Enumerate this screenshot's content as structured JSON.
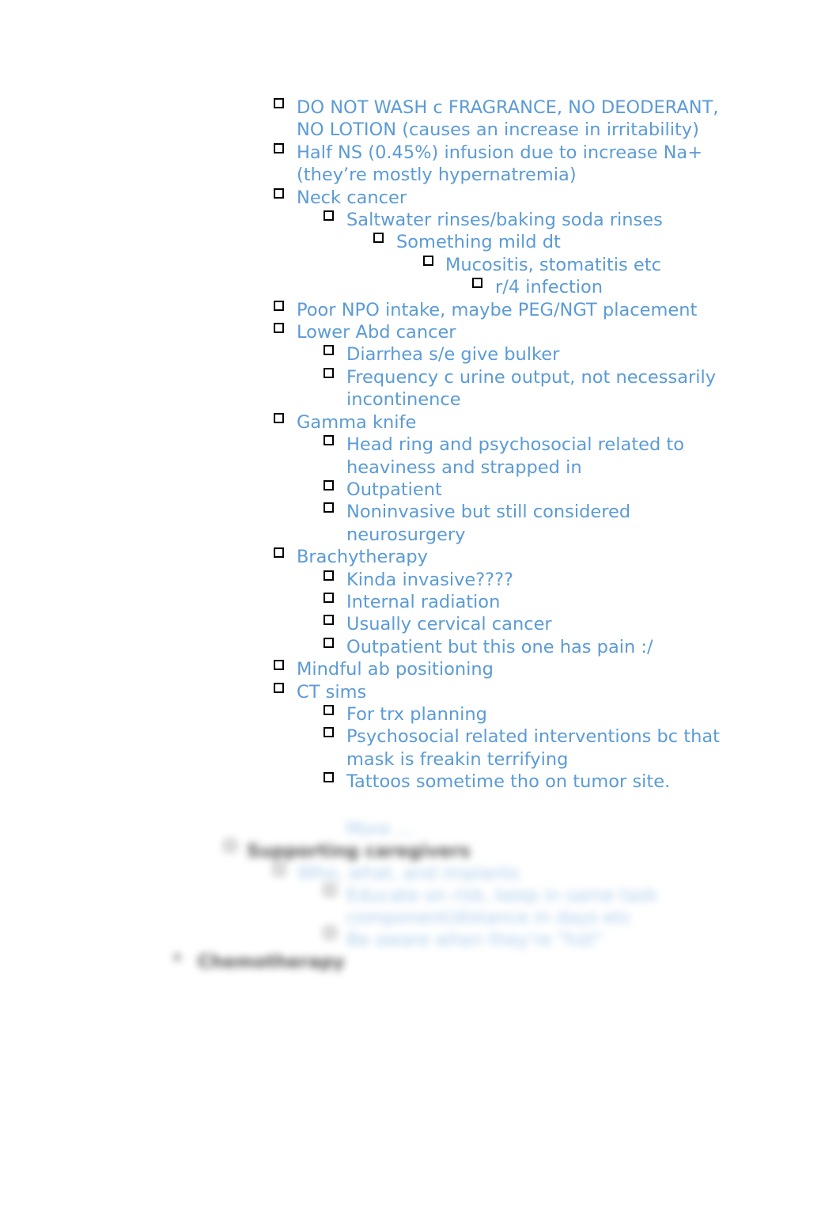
{
  "document": {
    "text_color": "#5b9bd5",
    "items": [
      {
        "level": 0,
        "text": "DO NOT WASH c FRAGRANCE, NO DEODERANT, NO LOTION (causes an increase in irritability)"
      },
      {
        "level": 0,
        "text": "Half NS (0.45%) infusion due to increase Na+ (they’re mostly hypernatremia)"
      },
      {
        "level": 0,
        "text": "Neck cancer"
      },
      {
        "level": 1,
        "text": "Saltwater rinses/baking soda rinses"
      },
      {
        "level": 2,
        "text": "Something mild dt"
      },
      {
        "level": 3,
        "text": "Mucositis, stomatitis etc"
      },
      {
        "level": 4,
        "text": "r/4 infection"
      },
      {
        "level": 0,
        "text": "Poor NPO intake, maybe PEG/NGT placement"
      },
      {
        "level": 0,
        "text": "Lower Abd cancer"
      },
      {
        "level": 1,
        "text": "Diarrhea s/e give bulker"
      },
      {
        "level": 1,
        "text": "Frequency c urine output, not necessarily incontinence"
      },
      {
        "level": 0,
        "text": "Gamma knife"
      },
      {
        "level": 1,
        "text": "Head ring and psychosocial related to heaviness and strapped in"
      },
      {
        "level": 1,
        "text": "Outpatient"
      },
      {
        "level": 1,
        "text": "Noninvasive but still considered neurosurgery"
      },
      {
        "level": 0,
        "text": "Brachytherapy"
      },
      {
        "level": 1,
        "text": "Kinda invasive????"
      },
      {
        "level": 1,
        "text": "Internal radiation"
      },
      {
        "level": 1,
        "text": "Usually cervical cancer"
      },
      {
        "level": 1,
        "text": "Outpatient but this one has pain :/"
      },
      {
        "level": 0,
        "text": "Mindful ab positioning"
      },
      {
        "level": 0,
        "text": "CT sims"
      },
      {
        "level": 1,
        "text": "For trx planning"
      },
      {
        "level": 1,
        "text": "Psychosocial related interventions bc that mask is freakin terrifying"
      },
      {
        "level": 1,
        "text": "Tattoos sometime tho on tumor site."
      }
    ],
    "blurred_preview": {
      "lines": [
        "More ...",
        "Supporting caregivers",
        "Who, what, and implants",
        "Educate on risk, keep in same task",
        "component/distance in days etc",
        "Be aware when they're \"hot\"",
        "Chemotherapy"
      ]
    }
  }
}
